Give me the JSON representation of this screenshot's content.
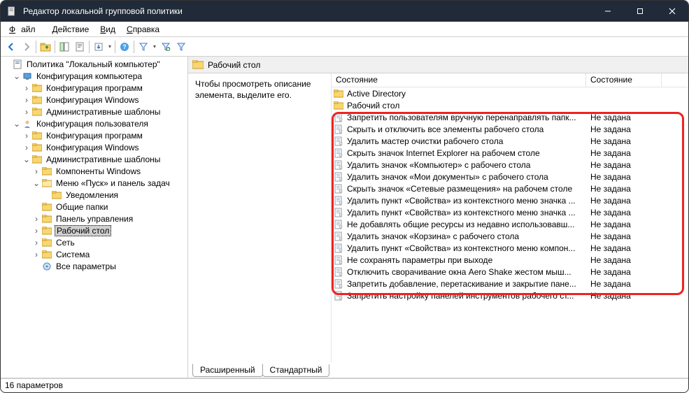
{
  "window": {
    "title": "Редактор локальной групповой политики"
  },
  "menu": {
    "file": "Файл",
    "action": "Действие",
    "view": "Вид",
    "help": "Справка"
  },
  "tree": {
    "root": "Политика \"Локальный компьютер\"",
    "compCfg": "Конфигурация компьютера",
    "cfgProg": "Конфигурация программ",
    "cfgWin": "Конфигурация Windows",
    "admTpl": "Административные шаблоны",
    "userCfg": "Конфигурация пользователя",
    "compWin": "Компоненты Windows",
    "startMenu": "Меню «Пуск» и панель задач",
    "notif": "Уведомления",
    "sharedFolders": "Общие папки",
    "controlPanel": "Панель управления",
    "desktop": "Рабочий стол",
    "network": "Сеть",
    "system": "Система",
    "allParams": "Все параметры"
  },
  "header": {
    "title": "Рабочий стол"
  },
  "desc": {
    "text": "Чтобы просмотреть описание элемента, выделите его."
  },
  "cols": {
    "c1": "Состояние",
    "c2": "Состояние"
  },
  "folders": [
    {
      "name": "Active Directory"
    },
    {
      "name": "Рабочий стол"
    }
  ],
  "items": [
    {
      "name": "Запретить пользователям вручную перенаправлять папк...",
      "state": "Не задана"
    },
    {
      "name": "Скрыть и отключить все элементы рабочего стола",
      "state": "Не задана"
    },
    {
      "name": "Удалить мастер очистки рабочего стола",
      "state": "Не задана"
    },
    {
      "name": "Скрыть значок Internet Explorer на рабочем столе",
      "state": "Не задана"
    },
    {
      "name": "Удалить значок «Компьютер» с рабочего стола",
      "state": "Не задана"
    },
    {
      "name": "Удалить значок «Мои документы» с рабочего стола",
      "state": "Не задана"
    },
    {
      "name": "Скрыть значок «Сетевые размещения» на рабочем столе",
      "state": "Не задана"
    },
    {
      "name": "Удалить пункт «Свойства» из контекстного меню значка ...",
      "state": "Не задана"
    },
    {
      "name": "Удалить пункт «Свойства» из контекстного меню значка ...",
      "state": "Не задана"
    },
    {
      "name": "Не добавлять общие ресурсы из недавно использовавш...",
      "state": "Не задана"
    },
    {
      "name": "Удалить значок «Корзина» с рабочего стола",
      "state": "Не задана"
    },
    {
      "name": "Удалить пункт «Свойства» из контекстного меню компон...",
      "state": "Не задана"
    },
    {
      "name": "Не сохранять параметры при выходе",
      "state": "Не задана"
    },
    {
      "name": "Отключить сворачивание окна Aero Shake жестом мыш...",
      "state": "Не задана"
    },
    {
      "name": "Запретить добавление, перетаскивание и закрытие пане...",
      "state": "Не задана"
    },
    {
      "name": "Запретить настройку панелей инструментов рабочего ст...",
      "state": "Не задана"
    }
  ],
  "tabs": {
    "ext": "Расширенный",
    "std": "Стандартный"
  },
  "status": {
    "text": "16 параметров"
  }
}
